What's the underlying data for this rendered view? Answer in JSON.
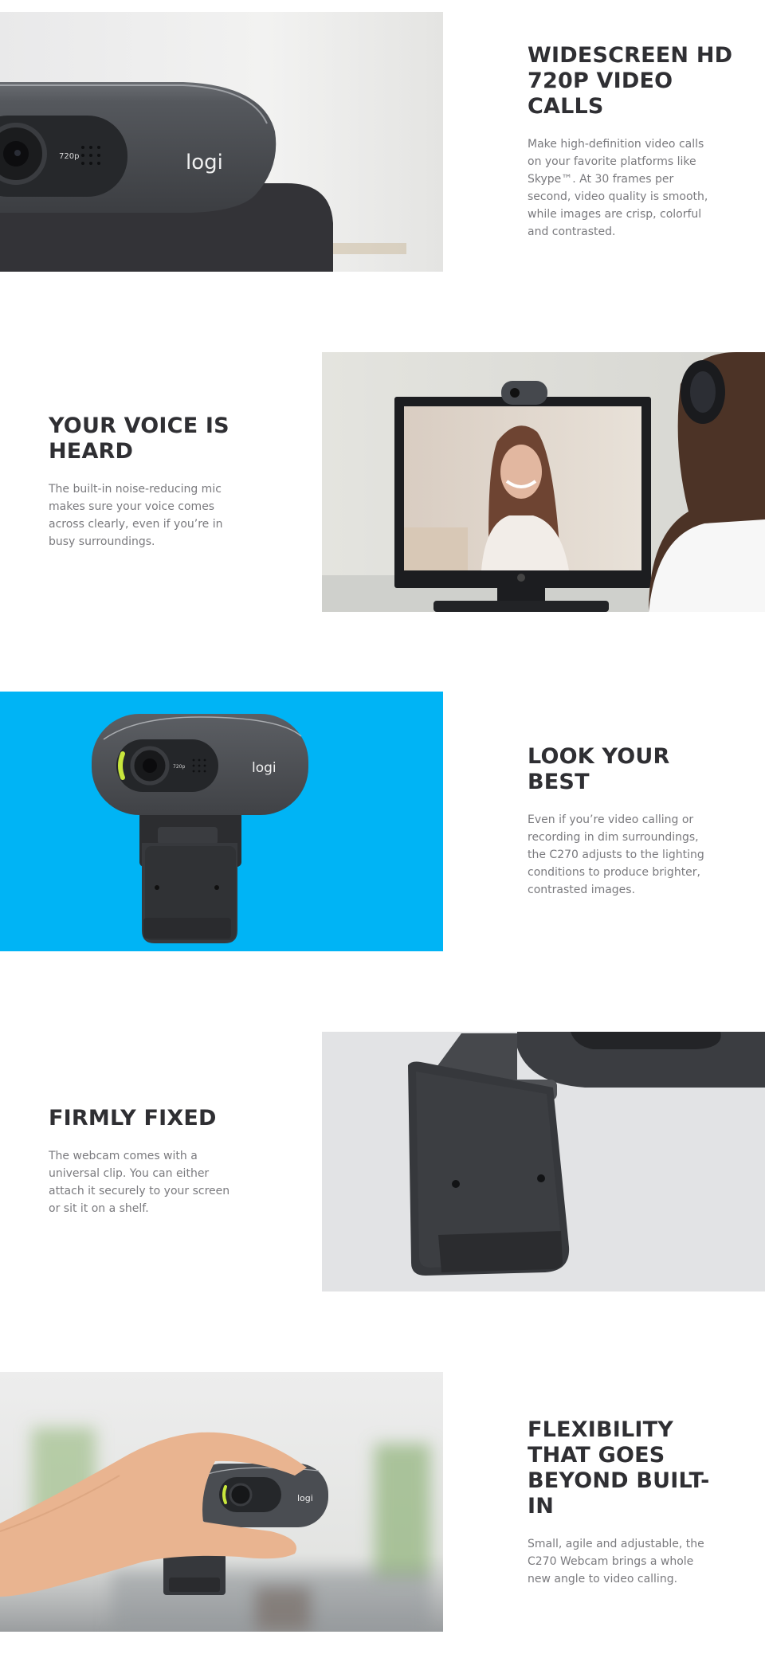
{
  "features": [
    {
      "title": "Widescreen HD 720p video calls",
      "description": "Make high-definition video calls on your favorite platforms like Skype™. At 30 frames per second, video quality is smooth, while images are crisp, colorful and contrasted.",
      "image_alt": "Close-up of webcam front with lens, 720p label and logi logo"
    },
    {
      "title": "Your voice is heard",
      "description": "The built-in noise-reducing mic makes sure your voice comes across clearly, even if you’re in busy surroundings.",
      "image_alt": "Woman with headphones on a video call with a smiling woman on a monitor"
    },
    {
      "title": "Look your best",
      "description": "Even if you’re video calling or recording in dim surroundings, the C270 adjusts to the lighting conditions to produce brighter, contrasted images.",
      "image_alt": "Webcam front view on blue background"
    },
    {
      "title": "Firmly fixed",
      "description": "The webcam comes with a universal clip. You can either attach it securely to your screen or sit it on a shelf.",
      "image_alt": "Close-up of webcam universal clip"
    },
    {
      "title": "Flexibility that goes beyond built-in",
      "description": "Small, agile and adjustable, the C270 Webcam brings a whole new angle to video calling.",
      "image_alt": "Hand holding the webcam in a bright room"
    }
  ],
  "product": {
    "brand_logo": "logi",
    "resolution_label": "720p"
  },
  "colors": {
    "heading": "#2f2f33",
    "body_text": "#7a7a7e",
    "blue_background": "#00b4f5",
    "clip_background": "#e2e3e5",
    "webcam_body": "#4a4d52",
    "led_green": "#c8e63c"
  }
}
